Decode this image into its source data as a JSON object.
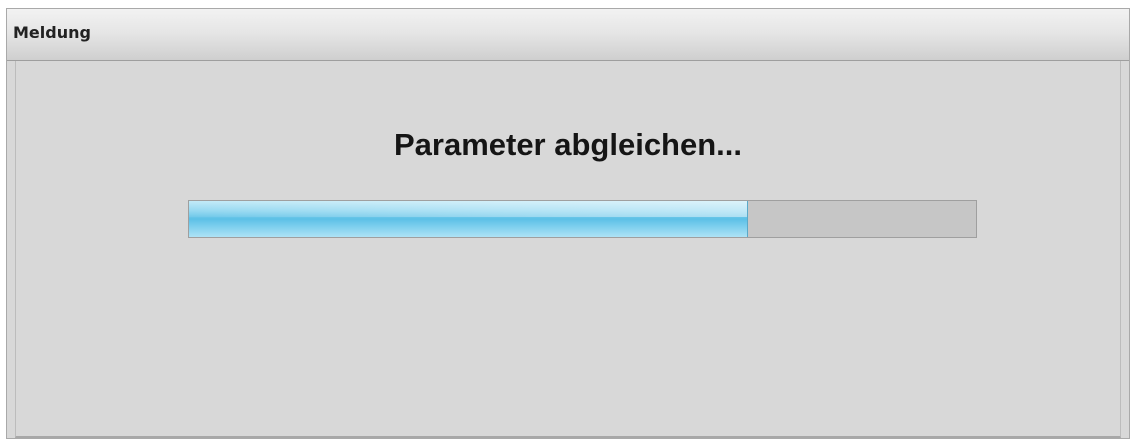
{
  "window": {
    "title": "Meldung"
  },
  "message": {
    "text": "Parameter abgleichen..."
  },
  "progress": {
    "value": 0.71,
    "fill_color": "#5cc0e6",
    "track_color": "#c6c6c6"
  }
}
